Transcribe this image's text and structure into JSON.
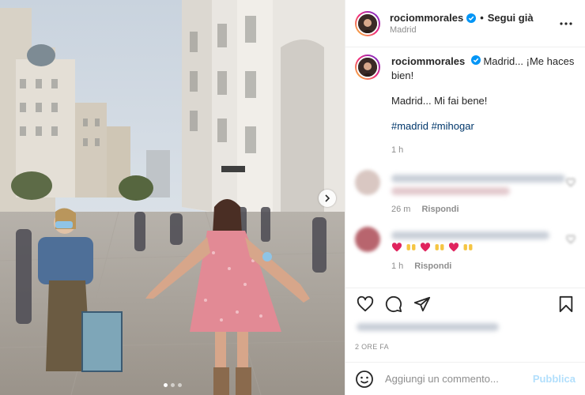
{
  "header": {
    "username": "rociommorales",
    "bullet": "•",
    "follow_label": "Segui già",
    "location": "Madrid"
  },
  "caption": {
    "username": "rociommorales",
    "text_line1": "Madrid... ¡Me haces bien!",
    "text_line2": "Madrid... Mi fai bene!",
    "hashtags": "#madrid #mihogar",
    "time": "1 h"
  },
  "comments": [
    {
      "time": "26 m",
      "reply_label": "Rispondi"
    },
    {
      "time": "1 h",
      "reply_label": "Rispondi"
    }
  ],
  "post_age": "2 ORE FA",
  "comment_input": {
    "placeholder": "Aggiungi un commento..."
  },
  "publish_label": "Pubblica",
  "icons": {
    "verified": "verified-badge-icon",
    "more": "more-options-icon",
    "like": "heart-icon",
    "comment": "comment-icon",
    "share": "share-icon",
    "save": "bookmark-icon",
    "emoji": "emoji-icon",
    "next": "chevron-right-icon"
  },
  "colors": {
    "verified": "#0095f6",
    "hashtag": "#00376b",
    "publish_disabled": "#b2dffc",
    "emoji_heart": "#e0245e"
  },
  "carousel": {
    "slides": 3,
    "current": 1
  }
}
